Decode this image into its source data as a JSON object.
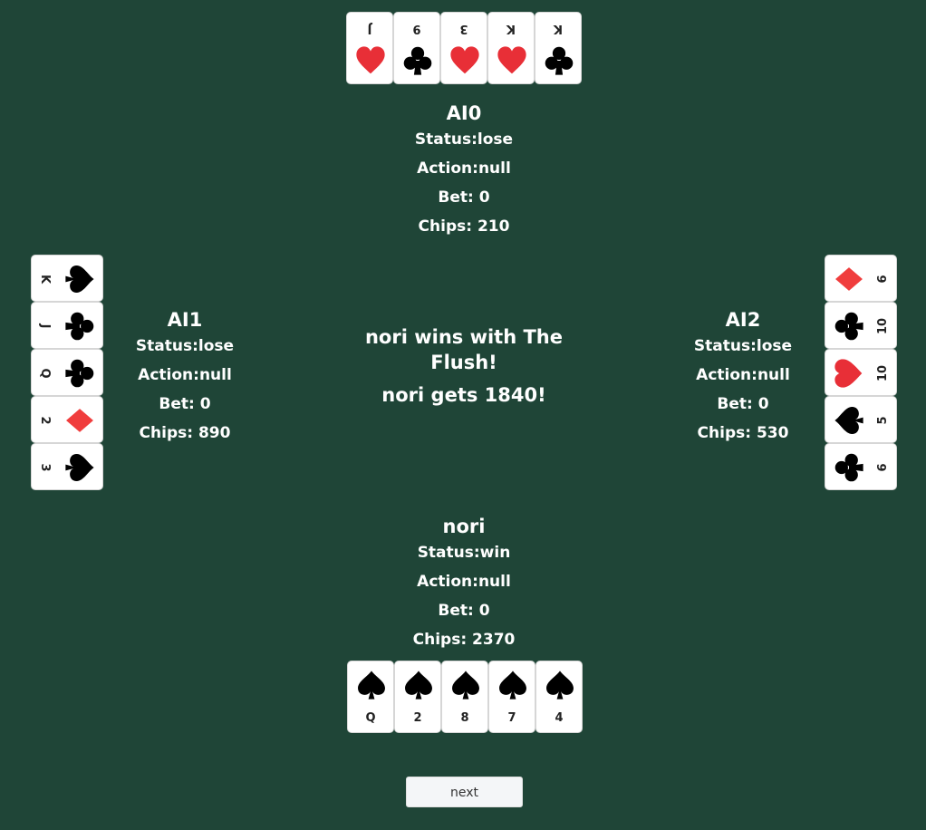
{
  "colors": {
    "table": "#1f4537",
    "red": "#e82f37",
    "diamond": "#f03d3d",
    "black": "#000000"
  },
  "players": {
    "top": {
      "name": "AI0",
      "status": "Status:lose",
      "action": "Action:null",
      "bet": "Bet: 0",
      "chips": "Chips: 210",
      "cards": [
        {
          "rank": "J",
          "suit": "heart"
        },
        {
          "rank": "9",
          "suit": "club"
        },
        {
          "rank": "3",
          "suit": "heart"
        },
        {
          "rank": "K",
          "suit": "heart"
        },
        {
          "rank": "K",
          "suit": "club"
        }
      ]
    },
    "left": {
      "name": "AI1",
      "status": "Status:lose",
      "action": "Action:null",
      "bet": "Bet: 0",
      "chips": "Chips: 890",
      "cards": [
        {
          "rank": "K",
          "suit": "spade"
        },
        {
          "rank": "J",
          "suit": "club"
        },
        {
          "rank": "Q",
          "suit": "club"
        },
        {
          "rank": "2",
          "suit": "diamond"
        },
        {
          "rank": "3",
          "suit": "spade"
        }
      ]
    },
    "right": {
      "name": "AI2",
      "status": "Status:lose",
      "action": "Action:null",
      "bet": "Bet: 0",
      "chips": "Chips: 530",
      "cards": [
        {
          "rank": "6",
          "suit": "diamond"
        },
        {
          "rank": "10",
          "suit": "club"
        },
        {
          "rank": "10",
          "suit": "heart"
        },
        {
          "rank": "5",
          "suit": "spade"
        },
        {
          "rank": "6",
          "suit": "club"
        }
      ]
    },
    "bottom": {
      "name": "nori",
      "status": "Status:win",
      "action": "Action:null",
      "bet": "Bet: 0",
      "chips": "Chips: 2370",
      "cards": [
        {
          "rank": "Q",
          "suit": "spade"
        },
        {
          "rank": "2",
          "suit": "spade"
        },
        {
          "rank": "8",
          "suit": "spade"
        },
        {
          "rank": "7",
          "suit": "spade"
        },
        {
          "rank": "4",
          "suit": "spade"
        }
      ]
    }
  },
  "message": {
    "winner_line": "nori wins with The Flush!",
    "gets_line": "nori gets 1840!"
  },
  "controls": {
    "next_label": "next"
  }
}
